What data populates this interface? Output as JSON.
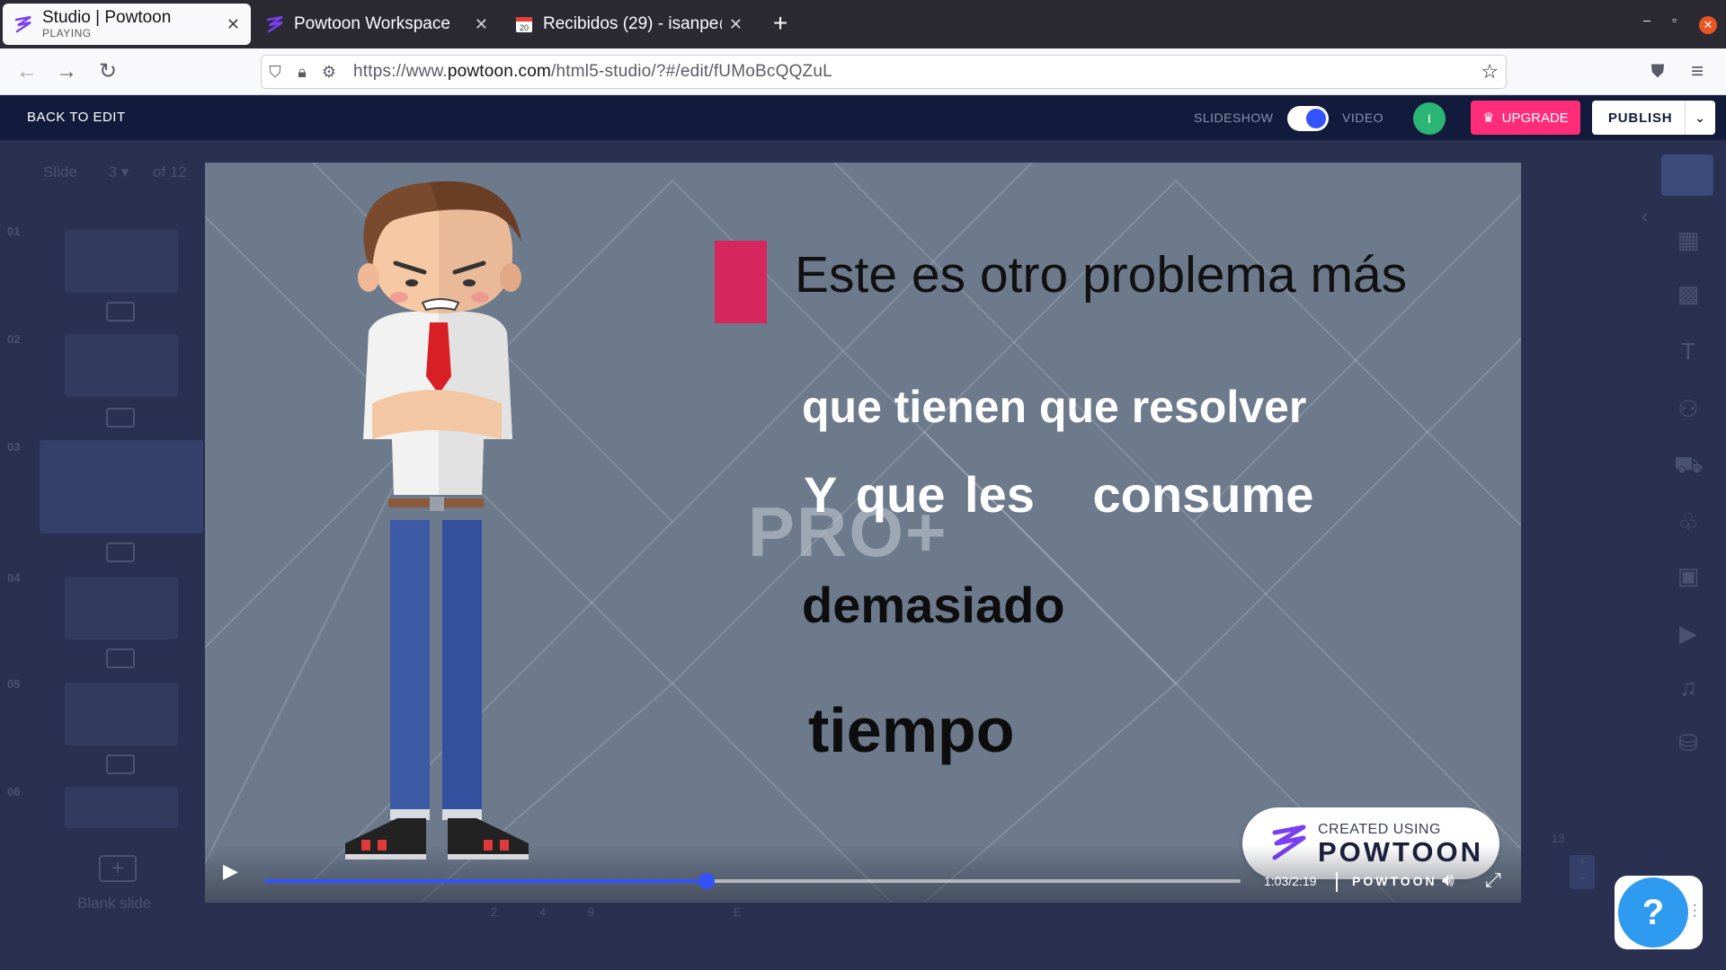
{
  "browser": {
    "tabs": [
      {
        "title": "Studio | Powtoon",
        "subtitle": "PLAYING"
      },
      {
        "title": "Powtoon Workspace"
      },
      {
        "title": "Recibidos (29) - isanpe@g"
      }
    ],
    "url_prefix": "https://www.",
    "url_domain": "powtoon.com",
    "url_path": "/html5-studio/?#/edit/fUMoBcQQZuL"
  },
  "studio": {
    "back_label": "BACK TO EDIT",
    "mode_slideshow": "SLIDESHOW",
    "mode_video": "VIDEO",
    "avatar_initial": "I",
    "upgrade_label": "UPGRADE",
    "publish_label": "PUBLISH"
  },
  "editor": {
    "slide_label": "Slide",
    "slide_current": "3",
    "slide_total": "of 12",
    "slide_numbers": [
      "01",
      "02",
      "03",
      "04",
      "05",
      "06"
    ],
    "blank_slide_label": "Blank slide",
    "timeline_numbers": [
      "2",
      "4",
      "9",
      "E"
    ],
    "side_number": "13"
  },
  "slide": {
    "heading": "Este es otro problema más",
    "line1": "que tienen que resolver",
    "line2": "Y que les   consume",
    "line3": "demasiado",
    "line4": "tiempo",
    "watermark": "PRO+",
    "badge_small": "CREATED USING",
    "badge_big": "POWTOON",
    "accent_color": "#d6265e"
  },
  "player": {
    "time": "1:03/2:19",
    "progress_fraction": 0.453,
    "brand": "POWTOON"
  },
  "help": {
    "label": "?"
  }
}
